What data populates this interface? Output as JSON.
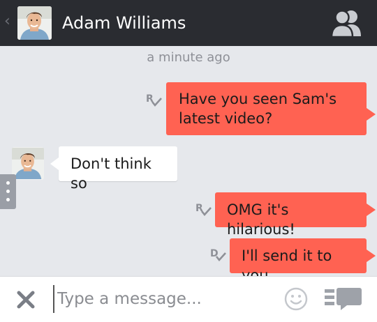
{
  "header": {
    "back_glyph": "‹",
    "contact_name": "Adam Williams",
    "avatar_icon": "contact-photo",
    "contacts_icon": "contacts-icon"
  },
  "chat": {
    "timestamp": "a minute ago",
    "messages": [
      {
        "direction": "outgoing",
        "text_line1": "Have you seen Sam's",
        "text_line2": "latest video?",
        "receipt": "R"
      },
      {
        "direction": "incoming",
        "text": "Don't think so"
      },
      {
        "direction": "outgoing",
        "text": "OMG it's hilarious!",
        "receipt": "R"
      },
      {
        "direction": "outgoing",
        "text": "I'll send it to you",
        "receipt": "D"
      }
    ]
  },
  "composer": {
    "placeholder": "Type a message...",
    "value": "",
    "close_icon": "close-icon",
    "emoji_icon": "smiley-icon",
    "stickers_icon": "sticker-chat-icon"
  },
  "colors": {
    "header_bg": "#2a2c31",
    "chat_bg": "#e6e8ec",
    "outgoing_bubble": "#ff6252",
    "incoming_bubble": "#ffffff",
    "receipt_color": "#8e9097"
  }
}
